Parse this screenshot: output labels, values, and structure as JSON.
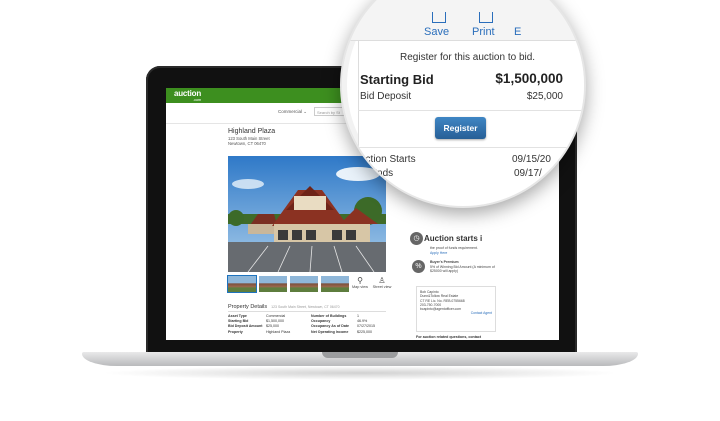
{
  "site": {
    "logo": "auction",
    "logo_sub": ".com",
    "category": "Commercial ⌄",
    "search_placeholder": "Search by St"
  },
  "property": {
    "title": "Highland Plaza",
    "address_line1": "123 South Main Street",
    "address_line2": "Newtown, CT 06470",
    "map_label": "Map view",
    "street_label": "Street view",
    "details_title": "Property Details",
    "details_subtitle": "123 South Main Street, Newtown, CT 06470",
    "details_left": [
      {
        "label": "Asset Type",
        "value": "Commercial"
      },
      {
        "label": "Starting Bid",
        "value": "$1,500,000"
      },
      {
        "label": "Bid Deposit Amount",
        "value": "$25,000"
      },
      {
        "label": "Property",
        "value": "Highland Plaza"
      }
    ],
    "details_right": [
      {
        "label": "Number of Buildings",
        "value": "1"
      },
      {
        "label": "Occupancy",
        "value": "46.9%"
      },
      {
        "label": "Occupancy As of Date",
        "value": "07/27/2015"
      },
      {
        "label": "Net Operating Income",
        "value": "$225,000"
      }
    ]
  },
  "sidebar": {
    "auction_starts_heading": "Auction starts i",
    "proof_text": "the proof of funds requirement.",
    "apply_here": "Apply Here",
    "buyers_premium_title": "Buyer's Premium",
    "buyers_premium_text": "5% of Winning Bid Amount (A minimum of $25000 will apply)",
    "contact_title": "Bob Capinto",
    "contact_company": "Dunn&Tollow Real Estate",
    "contact_license": "CT RE Lic. No. REB.0755668",
    "contact_phone": "203-750-7000",
    "contact_email": "bcapinto@agentofficer.com",
    "contact_agent": "Contact Agent",
    "questions": "For auction related questions, contact"
  },
  "magnifier": {
    "save": "Save",
    "print": "Print",
    "more": "E",
    "register_for": "Register for this auction to bid.",
    "starting_bid_label": "Starting Bid",
    "starting_bid_value": "$1,500,000",
    "bid_deposit_label": "Bid Deposit",
    "bid_deposit_value": "$25,000",
    "register_button": "Register",
    "auction_starts_label": "uction Starts",
    "auction_starts_value": "09/15/20",
    "auction_ends_label": "n Ends",
    "auction_ends_value": "09/17/"
  },
  "colors": {
    "brand_green": "#3d8f1f",
    "link_blue": "#2a6ebb",
    "button_blue": "#2f6fae"
  }
}
